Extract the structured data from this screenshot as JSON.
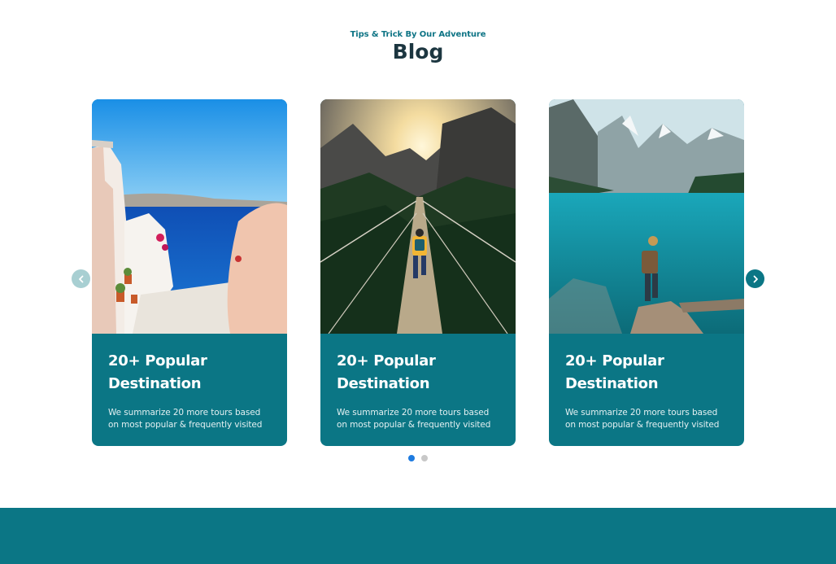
{
  "blog": {
    "eyebrow": "Tips & Trick By Our Adventure",
    "title": "Blog"
  },
  "cards": [
    {
      "title": "20+ Popular Destination",
      "text": "We summarize 20 more tours based on most popular & frequently visited",
      "image": "santorini-coast-photo"
    },
    {
      "title": "20+ Popular Destination",
      "text": "We summarize 20 more tours based on most popular & frequently visited",
      "image": "suspension-bridge-hiker-photo"
    },
    {
      "title": "20+ Popular Destination",
      "text": "We summarize 20 more tours based on most popular & frequently visited",
      "image": "mountain-lake-hiker-photo"
    }
  ],
  "carousel": {
    "prev_icon": "chevron-left-icon",
    "next_icon": "chevron-right-icon",
    "pages": 2,
    "active_page": 1
  },
  "colors": {
    "accent": "#0b7685",
    "heading": "#1c3640",
    "active_dot": "#1e7be0"
  }
}
